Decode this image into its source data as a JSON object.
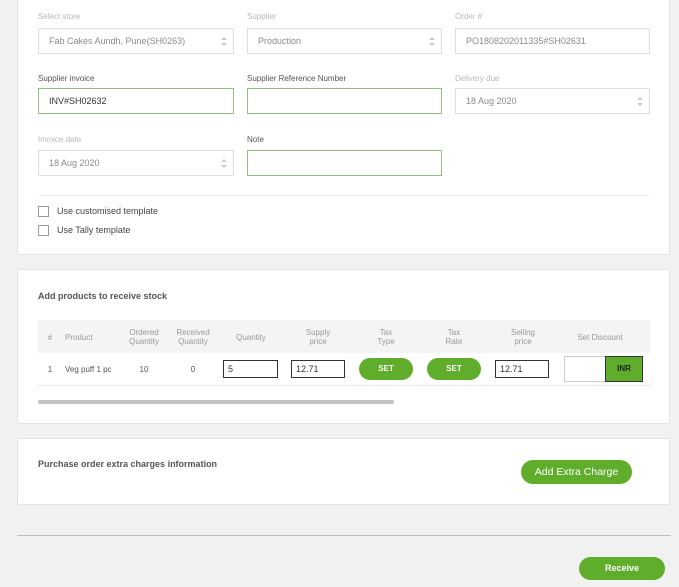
{
  "store": {
    "label": "Select store",
    "value": "Fab Cakes Aundh, Pune(SH0263)"
  },
  "supplier": {
    "label": "Supplier",
    "value": "Production"
  },
  "order": {
    "label": "Order #",
    "value": "PO1808202011335#SH02631"
  },
  "supplier_invoice": {
    "label": "Supplier invoice",
    "value": "INV#SH02632"
  },
  "supplier_ref": {
    "label": "Supplier Reference Number",
    "value": ""
  },
  "delivery_due": {
    "label": "Delivery due",
    "value": "18 Aug 2020"
  },
  "invoice_date": {
    "label": "Invoice date",
    "value": "18 Aug 2020"
  },
  "note": {
    "label": "Note",
    "value": ""
  },
  "options": {
    "custom_template": "Use customised template",
    "tally_template": "Use Tally template"
  },
  "products": {
    "title": "Add products to receive stock",
    "headers": [
      "#",
      "Product",
      "Ordered Quantity",
      "Received Quantity",
      "Quantity",
      "Supply price",
      "Tax Type",
      "Tax Rate",
      "Selling price",
      "Set Discount"
    ],
    "rows": [
      {
        "num": "1",
        "product": "Veg puff 1 pc",
        "ordered": "10",
        "received": "0",
        "quantity": "5",
        "supply_price": "12.71",
        "tax_type_btn": "SET",
        "tax_rate_btn": "SET",
        "selling_price": "12.71",
        "discount_value": "",
        "currency": "INR"
      }
    ]
  },
  "extra": {
    "title": "Purchase order extra charges information",
    "button": "Add Extra Charge"
  },
  "receive_button": "Receive",
  "colors": {
    "accent": "#5fad2b",
    "active_border": "#8fc27a"
  }
}
